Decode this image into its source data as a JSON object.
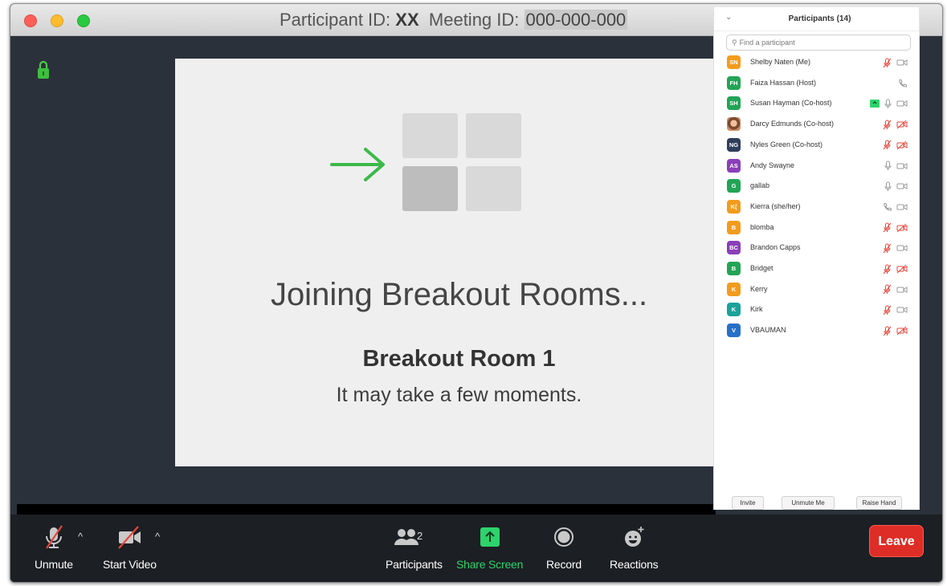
{
  "titlebar": {
    "participant_label": "Participant ID:",
    "participant_id": "XX",
    "meeting_label": "Meeting ID:",
    "meeting_id": "000-000-000"
  },
  "joining": {
    "title": "Joining Breakout Rooms...",
    "room": "Breakout Room 1",
    "message": "It may take a few moments."
  },
  "toolbar": {
    "unmute": "Unmute",
    "start_video": "Start Video",
    "participants": "Participants",
    "participants_count": "2",
    "share_screen": "Share Screen",
    "record": "Record",
    "reactions": "Reactions",
    "leave": "Leave"
  },
  "panel": {
    "title": "Participants (14)",
    "search_placeholder": "Find a participant",
    "participants": [
      {
        "initials": "SN",
        "name": "Shelby Naten (Me)",
        "color": "#f29b1d",
        "status": "muted-video-off"
      },
      {
        "initials": "FH",
        "name": "Faiza Hassan (Host)",
        "color": "#22a456",
        "status": "phone"
      },
      {
        "initials": "SH",
        "name": "Susan Hayman (Co-host)",
        "color": "#22a456",
        "status": "sharing"
      },
      {
        "initials": "",
        "name": "Darcy Edmunds (Co-host)",
        "color": "photo",
        "status": "muted-video-off-red"
      },
      {
        "initials": "NG",
        "name": "Nyles Green (Co-host)",
        "color": "#2f3e5a",
        "status": "muted-video-off-red"
      },
      {
        "initials": "AS",
        "name": "Andy Swayne",
        "color": "#8a3fb9",
        "status": "mic-video"
      },
      {
        "initials": "G",
        "name": "gallab",
        "color": "#22a456",
        "status": "mic-video"
      },
      {
        "initials": "K(",
        "name": "Kierra (she/her)",
        "color": "#f29b1d",
        "status": "phone-video"
      },
      {
        "initials": "B",
        "name": "blomba",
        "color": "#f29b1d",
        "status": "muted-video-off-red"
      },
      {
        "initials": "BC",
        "name": "Brandon Capps",
        "color": "#8a3fb9",
        "status": "muted-video"
      },
      {
        "initials": "B",
        "name": "Bridget",
        "color": "#22a456",
        "status": "muted-video-off-red"
      },
      {
        "initials": "K",
        "name": "Kerry",
        "color": "#f29b1d",
        "status": "muted-video"
      },
      {
        "initials": "K",
        "name": "Kirk",
        "color": "#1aa39a",
        "status": "muted-video"
      },
      {
        "initials": "V",
        "name": "VBAUMAN",
        "color": "#2670c7",
        "status": "muted-video-off-red"
      }
    ],
    "footer": {
      "invite": "Invite",
      "unmute_me": "Unmute Me",
      "raise_hand": "Raise Hand"
    }
  },
  "colors": {
    "accent_green": "#2ed36c",
    "leave_red": "#de2d26",
    "muted_red": "#e8463c"
  }
}
